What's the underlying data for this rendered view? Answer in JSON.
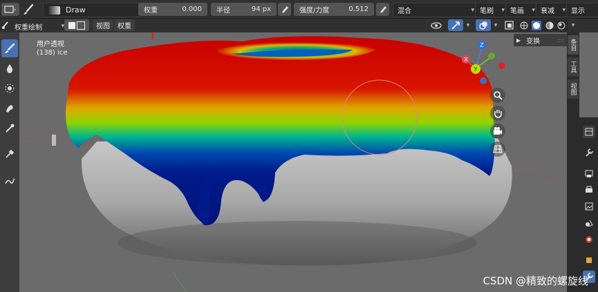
{
  "header": {
    "brush_name": "Draw",
    "weight_label": "权重",
    "weight_value": "0.000",
    "radius_label": "半径",
    "radius_value": "94 px",
    "strength_label": "强度/力度",
    "strength_value": "0.512",
    "blend_label": "混合",
    "brush_menu": "笔刷",
    "stroke_menu": "笔画",
    "falloff_menu": "衰减",
    "display_menu": "显示"
  },
  "header2": {
    "mode_label": "权重绘制",
    "view_menu": "视图",
    "weights_menu": "权重"
  },
  "viewport": {
    "perspective_label": "用户透视",
    "object_label": "(138) ice",
    "gizmo_z": "Z",
    "gizmo_y": "Y",
    "gizmo_x": "X"
  },
  "side_panel": {
    "transform_label": "变换",
    "tabs": [
      "条目",
      "工具",
      "视图"
    ]
  },
  "watermark": "CSDN @精致的螺旋线",
  "colors": {
    "annotation_arrow": "#e02020",
    "brush_circle": "#d98a8a",
    "active_tool": "#4772b3"
  }
}
